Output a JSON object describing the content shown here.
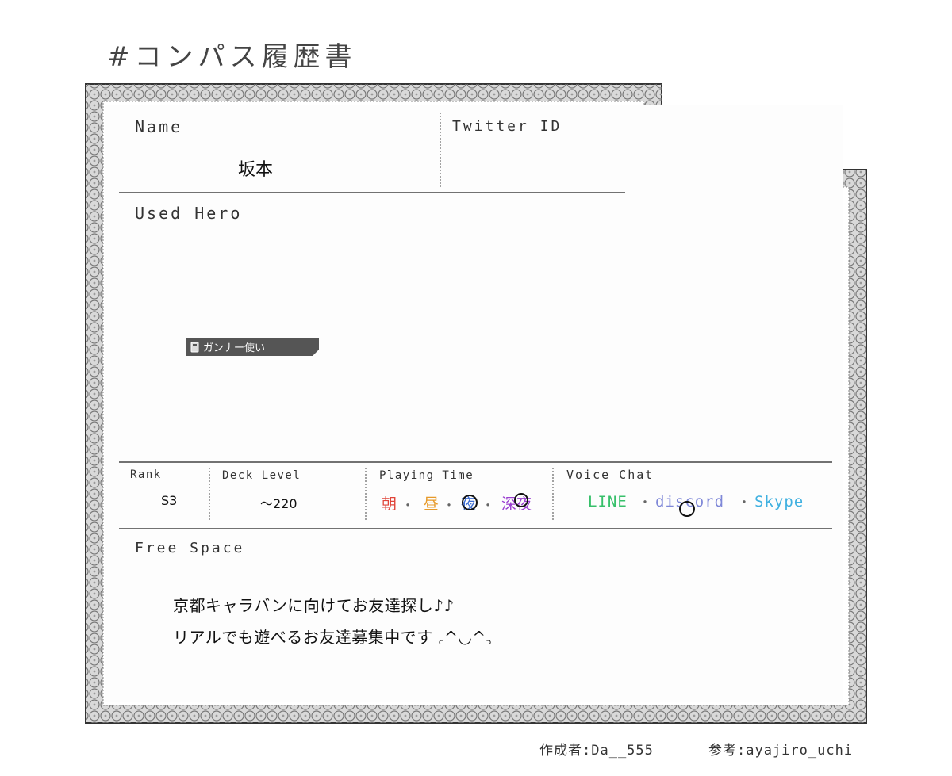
{
  "title": "#コンパス履歴書",
  "name": {
    "label": "Name",
    "value": "坂本"
  },
  "twitter": {
    "label": "Twitter ID",
    "value": ""
  },
  "used_hero": {
    "label": "Used Hero",
    "badge": "ガンナー使い"
  },
  "rank": {
    "label": "Rank",
    "value": "S3"
  },
  "deck_level": {
    "label": "Deck Level",
    "value": "～220"
  },
  "playing_time": {
    "label": "Playing Time",
    "options": [
      "朝",
      "昼",
      "夜",
      "深夜"
    ],
    "colors": [
      "#e0453a",
      "#e79a2a",
      "#3f6fd4",
      "#9a3fd0"
    ],
    "separator": "・",
    "circled": [
      "夜",
      "深夜"
    ]
  },
  "voice_chat": {
    "label": "Voice Chat",
    "options": [
      "LINE",
      "discord",
      "Skype"
    ],
    "colors": [
      "#37c06a",
      "#7f88d8",
      "#3fb0e0"
    ],
    "separator": "・",
    "circled": [
      "discord"
    ]
  },
  "free_space": {
    "label": "Free Space",
    "lines": [
      "京都キャラバンに向けてお友達探し♪♪",
      "リアルでも遊べるお友達募集中です ꜀^◡^꜆"
    ]
  },
  "footer": {
    "author": "作成者:Da__555",
    "reference": "参考:ayajiro_uchi"
  }
}
